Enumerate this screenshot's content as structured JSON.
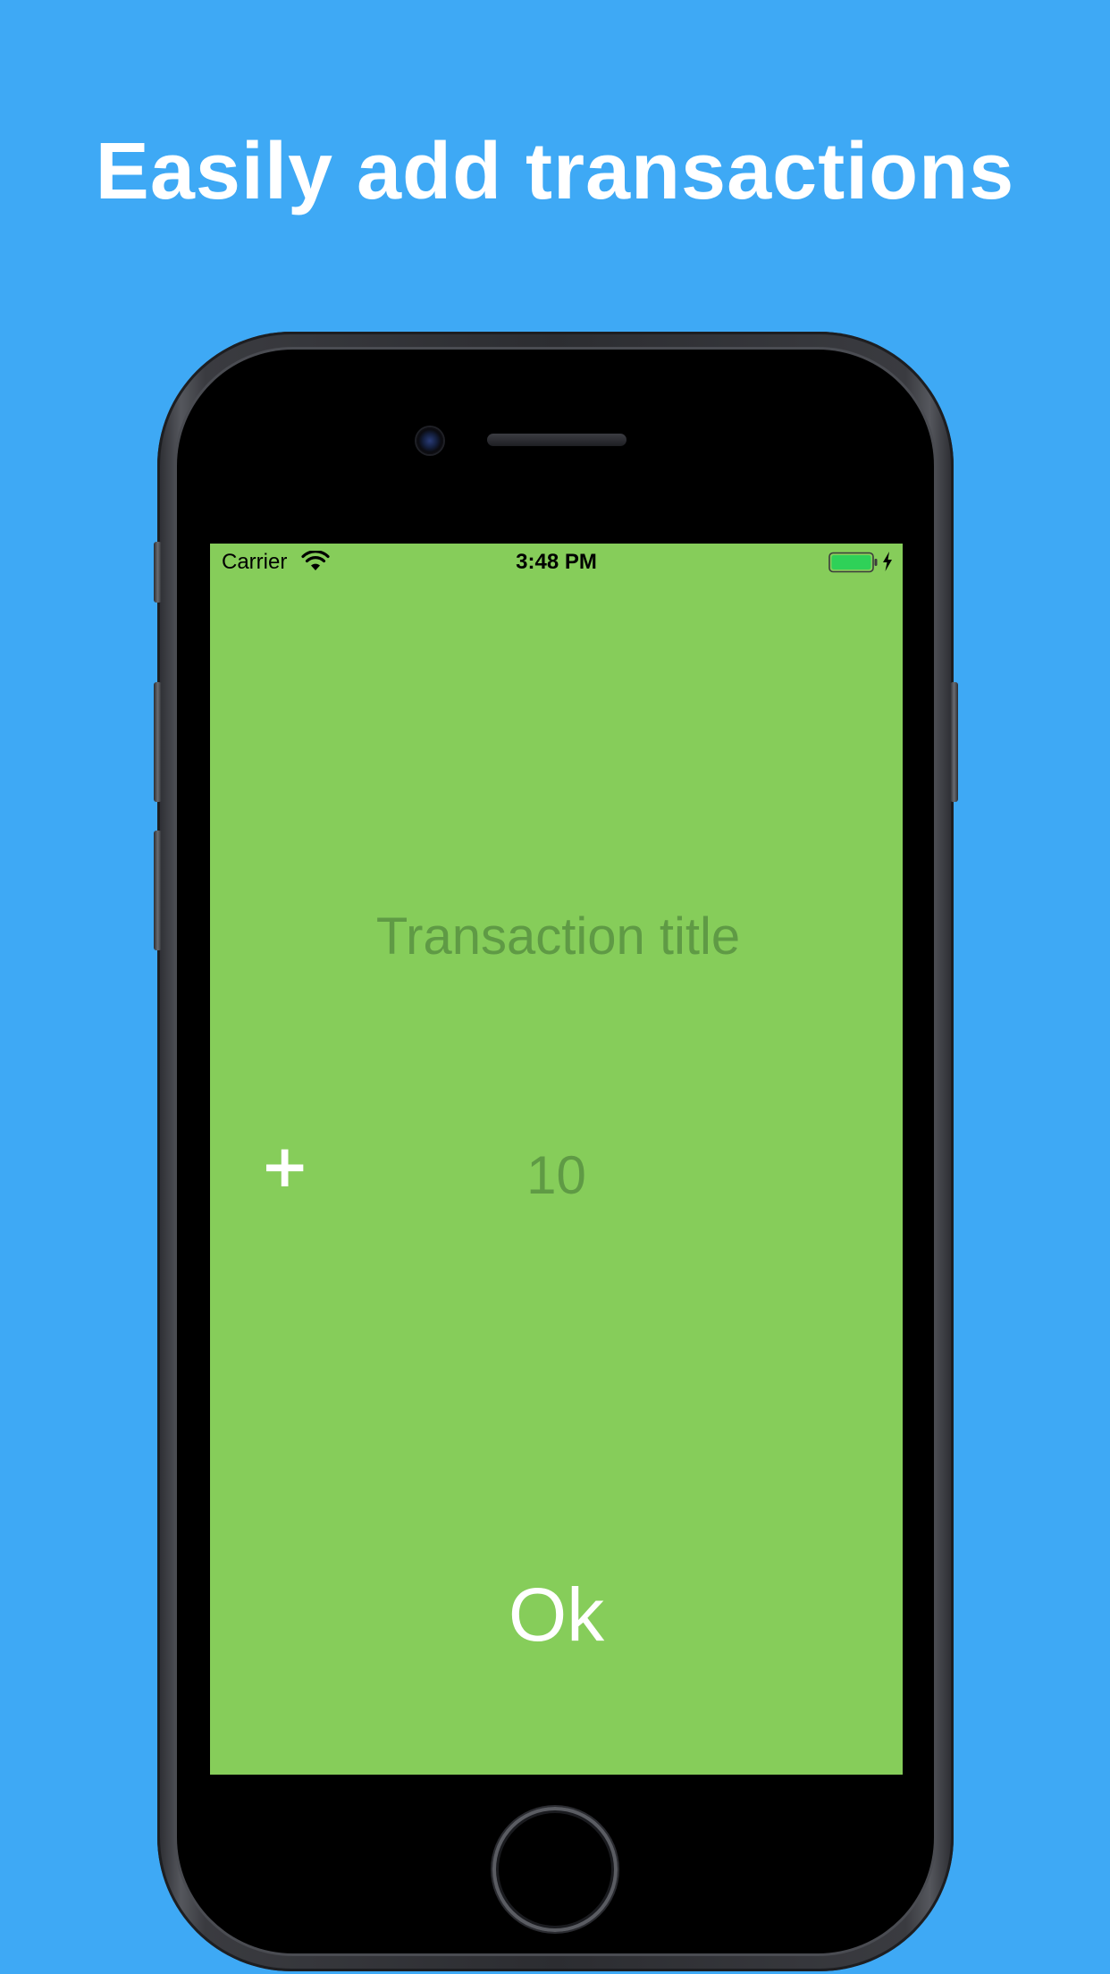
{
  "headline": "Easily add transactions",
  "status_bar": {
    "carrier": "Carrier",
    "wifi_icon": "wifi-icon",
    "time": "3:48 PM",
    "battery_icon": "battery-icon",
    "charging_icon": "bolt-icon"
  },
  "form": {
    "title_placeholder": "Transaction title",
    "sign_label": "+",
    "amount_value": "10",
    "ok_label": "Ok"
  },
  "colors": {
    "background": "#3EA9F5",
    "screen": "#86CD5A",
    "placeholder_text": "#5F9A45",
    "light_text": "#FFFFFF"
  }
}
